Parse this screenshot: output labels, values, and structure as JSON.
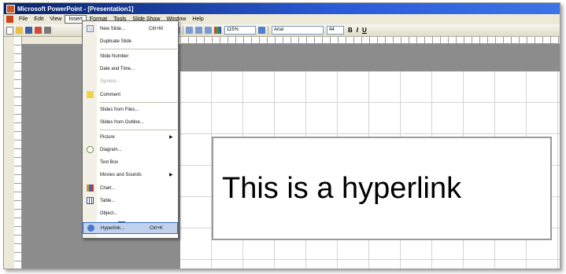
{
  "window": {
    "title": "Microsoft PowerPoint - [Presentation1]"
  },
  "menubar": [
    {
      "label": "File"
    },
    {
      "label": "Edit"
    },
    {
      "label": "View"
    },
    {
      "label": "Insert"
    },
    {
      "label": "Format"
    },
    {
      "label": "Tools"
    },
    {
      "label": "Slide Show"
    },
    {
      "label": "Window"
    },
    {
      "label": "Help"
    }
  ],
  "toolbar": {
    "zoom": "115%",
    "font": "Arial",
    "font_size": "44",
    "bold": "B",
    "italic": "I",
    "underline": "U"
  },
  "insert_menu": {
    "items": [
      {
        "label": "New Slide...",
        "shortcut": "Ctrl+M",
        "icon": "new-slide-icon"
      },
      {
        "label": "Duplicate Slide",
        "shortcut": "",
        "icon": ""
      },
      {
        "label": "Slide Number",
        "shortcut": "",
        "icon": ""
      },
      {
        "label": "Date and Time...",
        "shortcut": "",
        "icon": ""
      },
      {
        "label": "Symbol...",
        "shortcut": "",
        "icon": "",
        "disabled": true
      },
      {
        "label": "Comment",
        "shortcut": "",
        "icon": "comment-icon"
      },
      {
        "label": "Slides from Files...",
        "shortcut": "",
        "icon": ""
      },
      {
        "label": "Slides from Outline...",
        "shortcut": "",
        "icon": ""
      },
      {
        "label": "Picture",
        "shortcut": "",
        "icon": "",
        "submenu": true
      },
      {
        "label": "Diagram...",
        "shortcut": "",
        "icon": "diagram-icon"
      },
      {
        "label": "Text Box",
        "shortcut": "",
        "icon": "text-box-icon"
      },
      {
        "label": "Movies and Sounds",
        "shortcut": "",
        "icon": "",
        "submenu": true
      },
      {
        "label": "Chart...",
        "shortcut": "",
        "icon": "chart-icon"
      },
      {
        "label": "Table...",
        "shortcut": "",
        "icon": "table-icon"
      },
      {
        "label": "Object...",
        "shortcut": "",
        "icon": ""
      },
      {
        "label": "Hyperlink...",
        "shortcut": "Ctrl+K",
        "icon": "hyperlink-icon",
        "highlighted": true
      }
    ],
    "submenu_arrow": "▶"
  },
  "slide": {
    "textbox_text": "This is a hyperlink"
  }
}
